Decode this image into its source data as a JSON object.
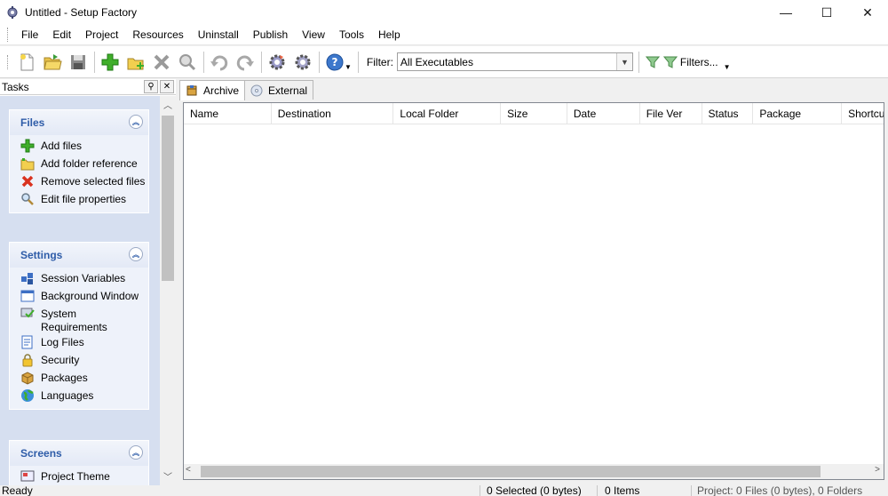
{
  "window": {
    "title": "Untitled - Setup Factory",
    "minimize": "—",
    "maximize": "☐",
    "close": "✕"
  },
  "menu": [
    "File",
    "Edit",
    "Project",
    "Resources",
    "Uninstall",
    "Publish",
    "View",
    "Tools",
    "Help"
  ],
  "toolbar": {
    "filter_label": "Filter:",
    "filter_value": "All Executables",
    "filters_button": "Filters..."
  },
  "tasks": {
    "title": "Tasks",
    "groups": [
      {
        "title": "Files",
        "items": [
          "Add files",
          "Add folder reference",
          "Remove selected files",
          "Edit file properties"
        ]
      },
      {
        "title": "Settings",
        "items": [
          "Session Variables",
          "Background Window",
          "System Requirements",
          "Log Files",
          "Security",
          "Packages",
          "Languages"
        ]
      },
      {
        "title": "Screens",
        "items": [
          "Project Theme"
        ]
      }
    ]
  },
  "tabs": [
    "Archive",
    "External"
  ],
  "columns": [
    "Name",
    "Destination",
    "Local Folder",
    "Size",
    "Date",
    "File Ver",
    "Status",
    "Package",
    "Shortcut"
  ],
  "status": {
    "left": "Ready",
    "selected": "0 Selected (0 bytes)",
    "items": "0 Items",
    "project": "Project: 0 Files (0 bytes), 0 Folders"
  },
  "colors": {
    "group_title": "#2e5ca8",
    "task_panel_bg": "#d6dff0"
  }
}
